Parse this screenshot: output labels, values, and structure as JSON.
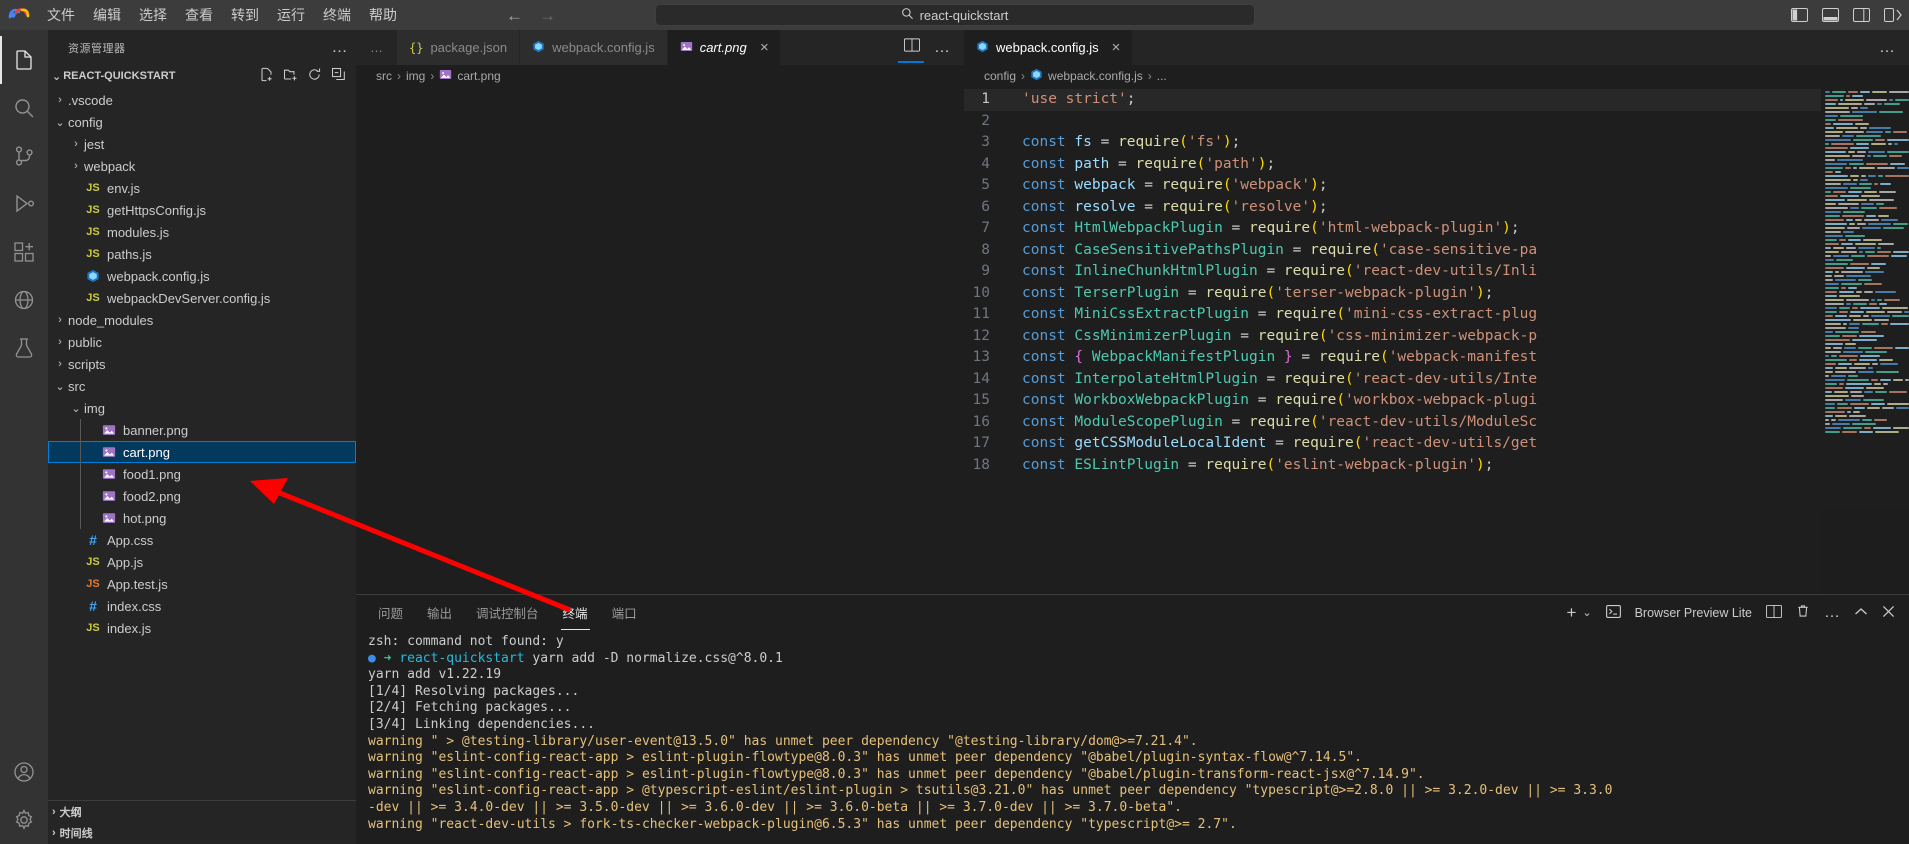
{
  "app": {
    "logo": "vscode-logo",
    "search_value": "react-quickstart",
    "search_icon": "search-icon"
  },
  "menu": {
    "items": [
      {
        "label": "文件",
        "name": "menu-file"
      },
      {
        "label": "编辑",
        "name": "menu-edit"
      },
      {
        "label": "选择",
        "name": "menu-selection"
      },
      {
        "label": "查看",
        "name": "menu-view"
      },
      {
        "label": "转到",
        "name": "menu-go"
      },
      {
        "label": "运行",
        "name": "menu-run"
      },
      {
        "label": "终端",
        "name": "menu-terminal"
      },
      {
        "label": "帮助",
        "name": "menu-help"
      }
    ],
    "back": "←",
    "forward": "→"
  },
  "titlebar_right": {
    "toggle_primary_sidebar": "toggle-primary-sidebar-icon",
    "toggle_panel": "toggle-panel-icon",
    "toggle_secondary_sidebar": "toggle-secondary-sidebar-icon",
    "customize_layout": "customize-layout-icon"
  },
  "activitybar": {
    "items": [
      {
        "name": "explorer",
        "icon": "files-icon",
        "active": true
      },
      {
        "name": "search",
        "icon": "search-icon",
        "active": false
      },
      {
        "name": "source-control",
        "icon": "source-control-icon",
        "active": false
      },
      {
        "name": "run-and-debug",
        "icon": "debug-icon",
        "active": false
      },
      {
        "name": "extensions",
        "icon": "extensions-icon",
        "active": false
      },
      {
        "name": "remote-explorer",
        "icon": "remote-explorer-icon",
        "active": false
      },
      {
        "name": "testing",
        "icon": "beaker-icon",
        "active": false
      }
    ],
    "bottom": [
      {
        "name": "accounts",
        "icon": "account-icon"
      },
      {
        "name": "manage",
        "icon": "gear-icon"
      }
    ]
  },
  "sidebar": {
    "title": "资源管理器",
    "more_actions": "…",
    "project": {
      "name": "REACT-QUICKSTART",
      "expanded": true,
      "actions": [
        "new-file-icon",
        "new-folder-icon",
        "refresh-icon",
        "collapse-all-icon"
      ]
    },
    "tree": [
      {
        "label": ".vscode",
        "type": "folder",
        "depth": 1,
        "expanded": false
      },
      {
        "label": "config",
        "type": "folder",
        "depth": 1,
        "expanded": true
      },
      {
        "label": "jest",
        "type": "folder",
        "depth": 2,
        "expanded": false
      },
      {
        "label": "webpack",
        "type": "folder",
        "depth": 2,
        "expanded": false
      },
      {
        "label": "env.js",
        "type": "js",
        "depth": 2
      },
      {
        "label": "getHttpsConfig.js",
        "type": "js",
        "depth": 2
      },
      {
        "label": "modules.js",
        "type": "js",
        "depth": 2
      },
      {
        "label": "paths.js",
        "type": "js",
        "depth": 2
      },
      {
        "label": "webpack.config.js",
        "type": "webpack",
        "depth": 2
      },
      {
        "label": "webpackDevServer.config.js",
        "type": "js",
        "depth": 2
      },
      {
        "label": "node_modules",
        "type": "folder",
        "depth": 1,
        "expanded": false
      },
      {
        "label": "public",
        "type": "folder",
        "depth": 1,
        "expanded": false
      },
      {
        "label": "scripts",
        "type": "folder",
        "depth": 1,
        "expanded": false
      },
      {
        "label": "src",
        "type": "folder",
        "depth": 1,
        "expanded": true
      },
      {
        "label": "img",
        "type": "folder",
        "depth": 2,
        "expanded": true
      },
      {
        "label": "banner.png",
        "type": "img",
        "depth": 3
      },
      {
        "label": "cart.png",
        "type": "img",
        "depth": 3,
        "selected": true
      },
      {
        "label": "food1.png",
        "type": "img",
        "depth": 3
      },
      {
        "label": "food2.png",
        "type": "img",
        "depth": 3
      },
      {
        "label": "hot.png",
        "type": "img",
        "depth": 3
      },
      {
        "label": "App.css",
        "type": "css",
        "depth": 2
      },
      {
        "label": "App.js",
        "type": "js",
        "depth": 2
      },
      {
        "label": "App.test.js",
        "type": "test",
        "depth": 2
      },
      {
        "label": "index.css",
        "type": "css",
        "depth": 2
      },
      {
        "label": "index.js",
        "type": "js",
        "depth": 2
      }
    ],
    "outline": "大纲",
    "timeline": "时间线"
  },
  "editor_left": {
    "tabs": [
      {
        "label": "package.json",
        "icon": "json-icon",
        "active": false
      },
      {
        "label": "webpack.config.js",
        "icon": "webpack-icon",
        "active": false
      },
      {
        "label": "cart.png",
        "icon": "image-icon",
        "active": true,
        "preview": true,
        "close": "×"
      }
    ],
    "overflow": "…",
    "actions": {
      "split": "split-editor-icon",
      "more": "…"
    },
    "breadcrumb": [
      "src",
      "img",
      "cart.png"
    ],
    "breadcrumb_icon": "image-icon"
  },
  "editor_right": {
    "tabs": [
      {
        "label": "webpack.config.js",
        "icon": "webpack-icon",
        "active": true,
        "close": "×"
      }
    ],
    "actions": {
      "more": "…"
    },
    "breadcrumb": [
      "config",
      "webpack.config.js",
      "..."
    ],
    "breadcrumb_icon": "webpack-icon",
    "code_lines": [
      {
        "n": 1,
        "text": "'use strict';",
        "current": true
      },
      {
        "n": 2,
        "text": ""
      },
      {
        "n": 3,
        "text": "const fs = require('fs');"
      },
      {
        "n": 4,
        "text": "const path = require('path');"
      },
      {
        "n": 5,
        "text": "const webpack = require('webpack');"
      },
      {
        "n": 6,
        "text": "const resolve = require('resolve');"
      },
      {
        "n": 7,
        "text": "const HtmlWebpackPlugin = require('html-webpack-plugin');"
      },
      {
        "n": 8,
        "text": "const CaseSensitivePathsPlugin = require('case-sensitive-pa"
      },
      {
        "n": 9,
        "text": "const InlineChunkHtmlPlugin = require('react-dev-utils/Inli"
      },
      {
        "n": 10,
        "text": "const TerserPlugin = require('terser-webpack-plugin');"
      },
      {
        "n": 11,
        "text": "const MiniCssExtractPlugin = require('mini-css-extract-plug"
      },
      {
        "n": 12,
        "text": "const CssMinimizerPlugin = require('css-minimizer-webpack-p"
      },
      {
        "n": 13,
        "text": "const { WebpackManifestPlugin } = require('webpack-manifest"
      },
      {
        "n": 14,
        "text": "const InterpolateHtmlPlugin = require('react-dev-utils/Inte"
      },
      {
        "n": 15,
        "text": "const WorkboxWebpackPlugin = require('workbox-webpack-plugi"
      },
      {
        "n": 16,
        "text": "const ModuleScopePlugin = require('react-dev-utils/ModuleSc"
      },
      {
        "n": 17,
        "text": "const getCSSModuleLocalIdent = require('react-dev-utils/get"
      },
      {
        "n": 18,
        "text": "const ESLintPlugin = require('eslint-webpack-plugin');"
      }
    ]
  },
  "panel": {
    "tabs": [
      {
        "label": "问题",
        "name": "tab-problems",
        "active": false
      },
      {
        "label": "输出",
        "name": "tab-output",
        "active": false
      },
      {
        "label": "调试控制台",
        "name": "tab-debug-console",
        "active": false
      },
      {
        "label": "终端",
        "name": "tab-terminal",
        "active": true
      },
      {
        "label": "端口",
        "name": "tab-ports",
        "active": false
      }
    ],
    "actions": {
      "new_terminal": "+",
      "chevron": "⌄",
      "browser_preview_label": "Browser Preview Lite",
      "browser_preview_icon": "terminal-icon",
      "split": "split-terminal-icon",
      "kill": "trash-icon",
      "more": "…",
      "maximize": "chevron-up-icon",
      "close": "close-icon"
    },
    "terminal_lines": [
      {
        "cls": "plain",
        "text": "zsh: command not found: y"
      },
      {
        "cls": "prompt",
        "text": "react-quickstart yarn add -D normalize.css@^8.0.1"
      },
      {
        "cls": "plain",
        "text": ""
      },
      {
        "cls": "plain",
        "text": "yarn add v1.22.19"
      },
      {
        "cls": "plain",
        "text": "[1/4] Resolving packages..."
      },
      {
        "cls": "plain",
        "text": "[2/4] Fetching packages..."
      },
      {
        "cls": "plain",
        "text": "[3/4] Linking dependencies..."
      },
      {
        "cls": "warn",
        "text": "warning \" > @testing-library/user-event@13.5.0\" has unmet peer dependency \"@testing-library/dom@>=7.21.4\"."
      },
      {
        "cls": "warn",
        "text": "warning \"eslint-config-react-app > eslint-plugin-flowtype@8.0.3\" has unmet peer dependency \"@babel/plugin-syntax-flow@^7.14.5\"."
      },
      {
        "cls": "warn",
        "text": "warning \"eslint-config-react-app > eslint-plugin-flowtype@8.0.3\" has unmet peer dependency \"@babel/plugin-transform-react-jsx@^7.14.9\"."
      },
      {
        "cls": "warn",
        "text": "warning \"eslint-config-react-app > @typescript-eslint/eslint-plugin > tsutils@3.21.0\" has unmet peer dependency \"typescript@>=2.8.0 || >= 3.2.0-dev || >= 3.3.0"
      },
      {
        "cls": "warn-cont",
        "text": "-dev || >= 3.4.0-dev || >= 3.5.0-dev || >= 3.6.0-dev || >= 3.6.0-beta || >= 3.7.0-dev || >= 3.7.0-beta\"."
      },
      {
        "cls": "warn",
        "text": "warning \"react-dev-utils > fork-ts-checker-webpack-plugin@6.5.3\" has unmet peer dependency \"typescript@>= 2.7\"."
      }
    ],
    "prompt_symbol": "➜",
    "prompt_dot": "●"
  },
  "annotation": {
    "arrow": "red-arrow",
    "arrow_color": "#ff0000"
  }
}
